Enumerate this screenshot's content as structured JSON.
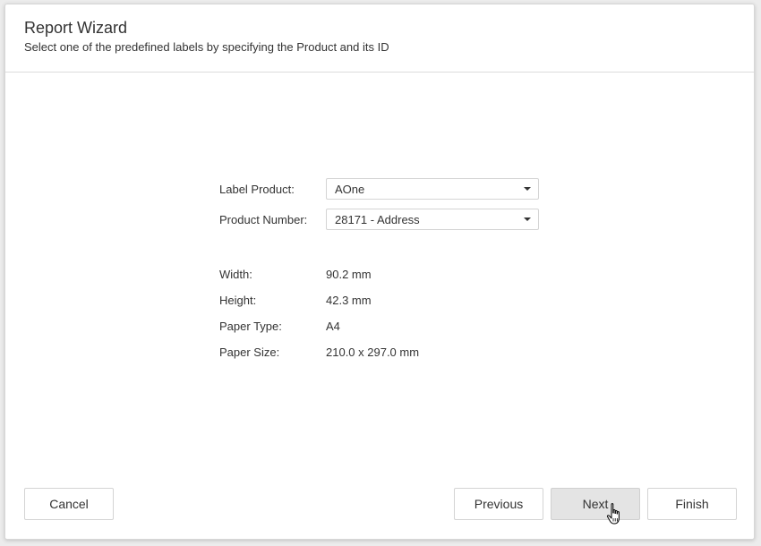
{
  "dialog": {
    "title": "Report Wizard",
    "subtitle": "Select one of the predefined labels by specifying the Product and its ID"
  },
  "form": {
    "label_product": {
      "label": "Label Product:",
      "value": "AOne"
    },
    "product_number": {
      "label": "Product Number:",
      "value": "28171 - Address"
    }
  },
  "details": [
    {
      "key": "Width:",
      "value": "90.2 mm"
    },
    {
      "key": "Height:",
      "value": "42.3 mm"
    },
    {
      "key": "Paper Type:",
      "value": "A4"
    },
    {
      "key": "Paper Size:",
      "value": "210.0 x 297.0 mm"
    }
  ],
  "buttons": {
    "cancel": "Cancel",
    "previous": "Previous",
    "next": "Next",
    "finish": "Finish"
  },
  "colors": {
    "hover_button": "#e4e4e4",
    "border": "#d4d4d4",
    "text": "#333333"
  },
  "icons": {
    "dropdown": "chevron-down-icon",
    "cursor": "hand-pointer-icon"
  }
}
